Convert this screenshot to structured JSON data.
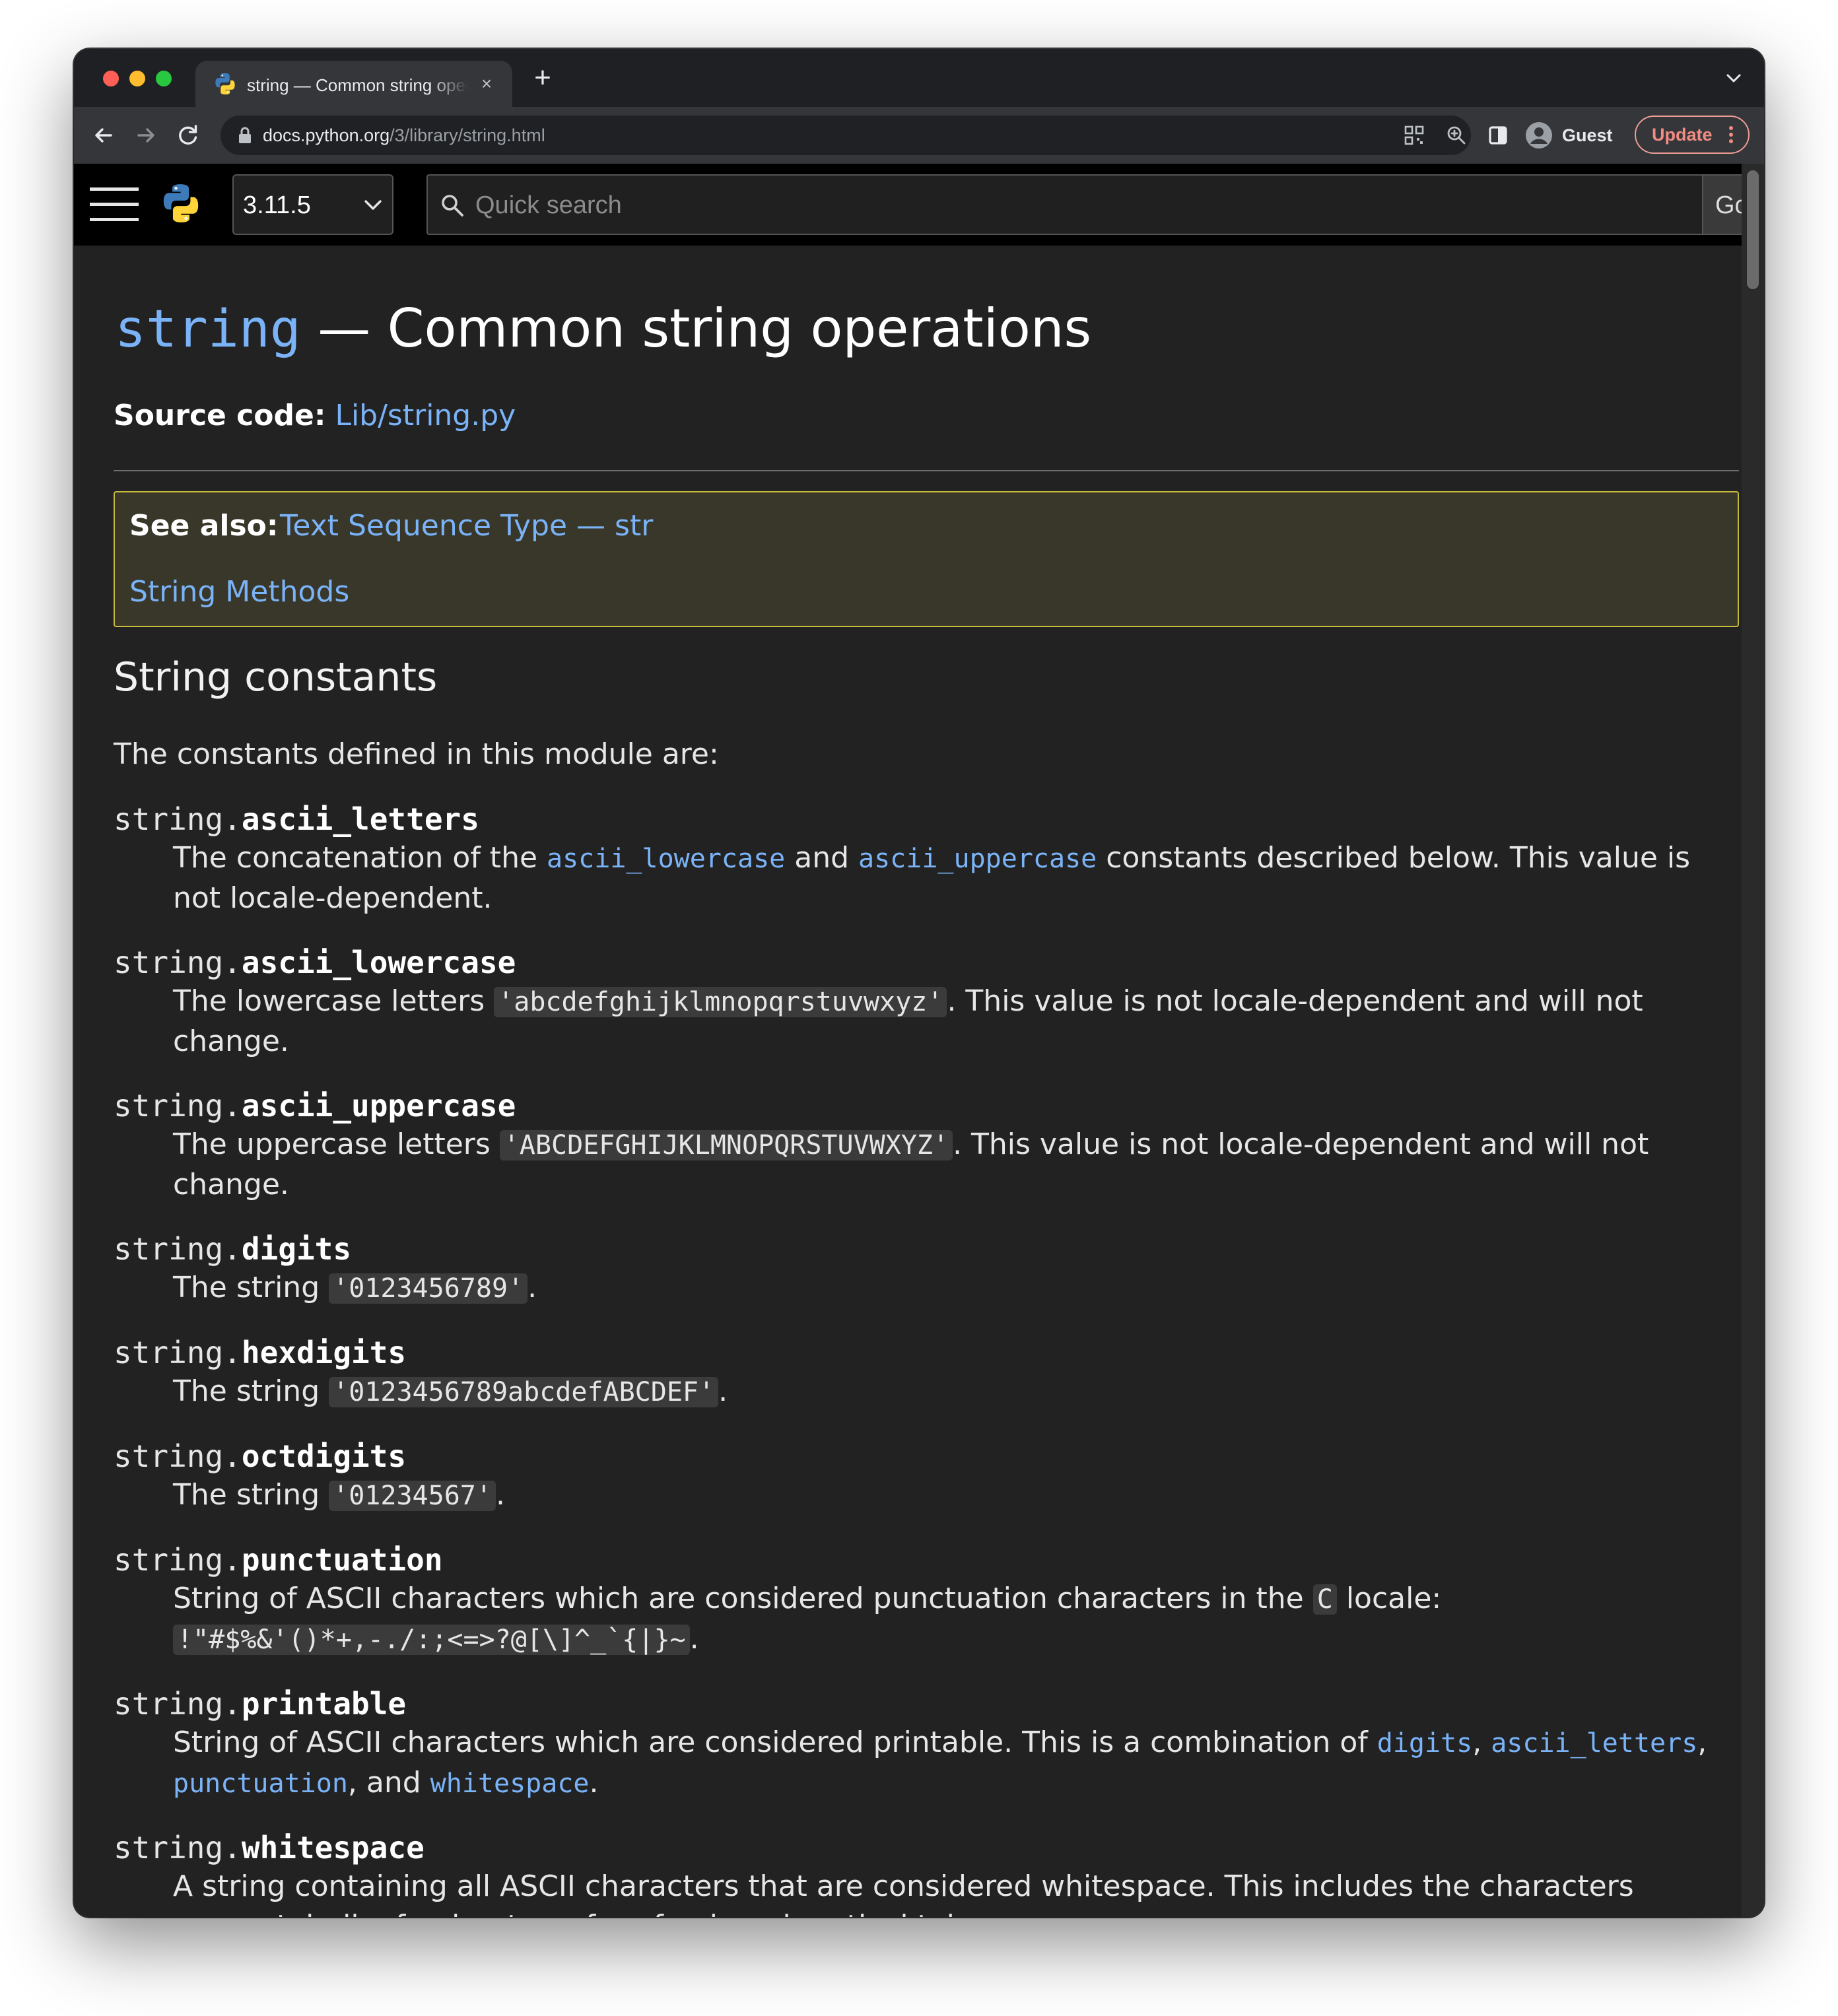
{
  "browser": {
    "traffic_lights": [
      "#ff5f57",
      "#febc2e",
      "#28c840"
    ],
    "tab": {
      "title": "string — Common string operations",
      "close": "×"
    },
    "new_tab": "+",
    "address_bar": {
      "host": "docs.python.org",
      "path": "/3/library/string.html"
    },
    "profile_label": "Guest",
    "update_label": "Update"
  },
  "docs_header": {
    "version": "3.11.5",
    "search_placeholder": "Quick search",
    "go_label": "Go"
  },
  "article": {
    "title_module": "string",
    "title_rest": " — Common string operations",
    "source_label": "Source code:",
    "source_link": "Lib/string.py",
    "see_also": {
      "label": "See also:",
      "links": [
        "Text Sequence Type — str",
        "String Methods"
      ]
    },
    "section_title": "String constants",
    "intro": "The constants defined in this module are:",
    "module_prefix": "string.",
    "constants": [
      {
        "name": "ascii_letters",
        "text1": "The concatenation of the ",
        "link1": "ascii_lowercase",
        "text2": " and ",
        "link2": "ascii_uppercase",
        "text3": " constants described below. This value is not locale-dependent."
      },
      {
        "name": "ascii_lowercase",
        "text1": "The lowercase letters ",
        "code": "'abcdefghijklmnopqrstuvwxyz'",
        "text2": ". This value is not locale-dependent and will not change."
      },
      {
        "name": "ascii_uppercase",
        "text1": "The uppercase letters ",
        "code": "'ABCDEFGHIJKLMNOPQRSTUVWXYZ'",
        "text2": ". This value is not locale-dependent and will not change."
      },
      {
        "name": "digits",
        "text1": "The string ",
        "code": "'0123456789'",
        "text2": "."
      },
      {
        "name": "hexdigits",
        "text1": "The string ",
        "code": "'0123456789abcdefABCDEF'",
        "text2": "."
      },
      {
        "name": "octdigits",
        "text1": "The string ",
        "code": "'01234567'",
        "text2": "."
      },
      {
        "name": "punctuation",
        "text1": "String of ASCII characters which are considered punctuation characters in the ",
        "code1": "C",
        "text2": " locale: ",
        "code2": "!\"#$%&'()*+,-./:;<=>?@[\\]^_`{|}~",
        "text3": "."
      },
      {
        "name": "printable",
        "text1": "String of ASCII characters which are considered printable. This is a combination of ",
        "link1": "digits",
        "text2": ", ",
        "link2": "ascii_letters",
        "text3": ", ",
        "link3": "punctuation",
        "text4": ", and ",
        "link4": "whitespace",
        "text5": "."
      },
      {
        "name": "whitespace",
        "text1": "A string containing all ASCII characters that are considered whitespace. This includes the characters space, tab, linefeed, return, formfeed, and vertical tab."
      }
    ]
  },
  "colors": {
    "page_background": "#222222",
    "link": "#7ab3f7",
    "see_also_background": "#39372a",
    "see_also_border": "#c7bb3c",
    "update_accent": "#f28b82"
  },
  "icons": [
    "python-logo-icon",
    "lock-icon",
    "qr-code-icon",
    "zoom-icon",
    "side-panel-icon",
    "profile-avatar-icon",
    "kebab-menu-icon",
    "hamburger-menu-icon",
    "search-icon",
    "chevron-down-icon"
  ]
}
